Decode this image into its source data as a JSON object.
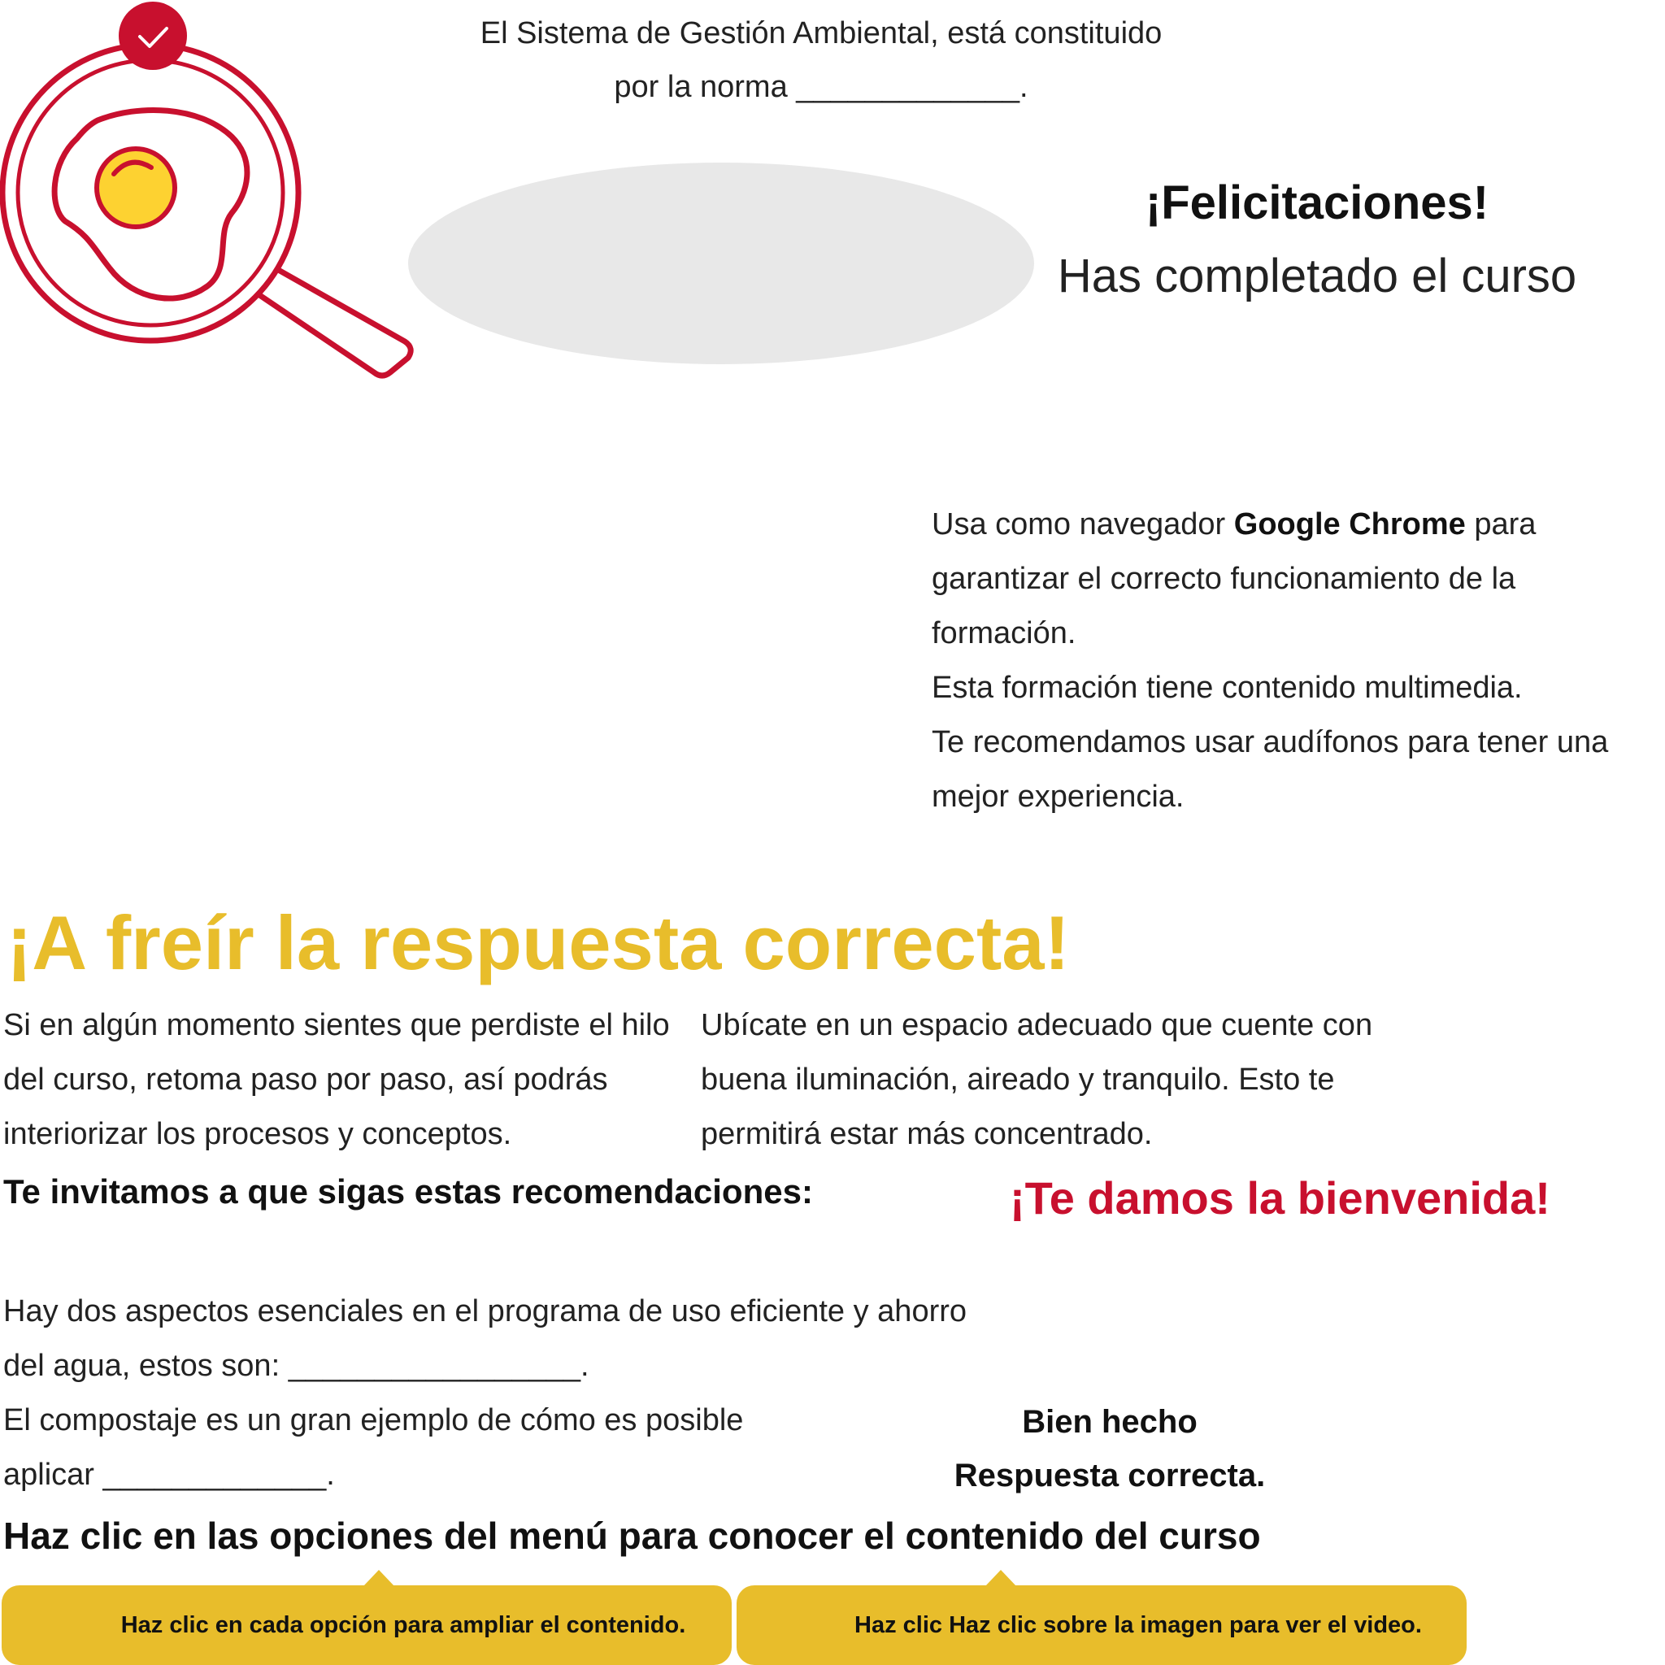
{
  "question_1": {
    "line1": "El Sistema de Gestión Ambiental, está constituido",
    "line2_prefix": "por la norma",
    "blank": "_____________",
    "suffix": "."
  },
  "congrats": {
    "title": "¡Felicitaciones!",
    "subtitle": "Has completado el curso"
  },
  "browser_info": {
    "prefix": "Usa como navegador",
    "browser": "Google Chrome",
    "rest": "para garantizar el correcto funcionamiento de la formación.",
    "line2": "Esta formación tiene contenido multimedia.",
    "line3": "Te recomendamos usar audífonos para tener una mejor experiencia."
  },
  "game_title": "¡A freír la respuesta correcta!",
  "tip_left": "Si en algún momento sientes que perdiste el hilo del curso, retoma paso por paso, así podrás interiorizar los procesos y conceptos.",
  "tip_right": "Ubícate en un espacio adecuado que cuente con buena iluminación, aireado y tranquilo. Esto te permitirá estar más concentrado.",
  "invite": "Te invitamos a que sigas estas recomendaciones:",
  "welcome": "¡Te damos la bienvenida!",
  "question_2": {
    "text": "Hay dos aspectos esenciales en el programa de uso eficiente y ahorro del agua, estos son:",
    "blank": "_________________",
    "suffix": "."
  },
  "question_3": {
    "text": "El compostaje es un gran ejemplo de cómo es posible aplicar",
    "blank": "_____________",
    "suffix": "."
  },
  "feedback": {
    "title": "Bien hecho",
    "subtitle": "Respuesta correcta."
  },
  "menu_instruction": "Haz clic en las opciones del menú para conocer el contenido del curso",
  "tooltips": [
    {
      "text": "Haz clic en cada opción para ampliar el contenido."
    },
    {
      "text": "Haz clic Haz clic sobre la imagen para ver el video."
    }
  ],
  "icons": {
    "pan": "frying-pan-egg-icon",
    "check": "check-badge-icon"
  },
  "colors": {
    "accent_yellow": "#e8bd2b",
    "accent_red": "#c8102e",
    "egg_yolk": "#fdd231",
    "placeholder_gray": "#e8e8e8"
  }
}
